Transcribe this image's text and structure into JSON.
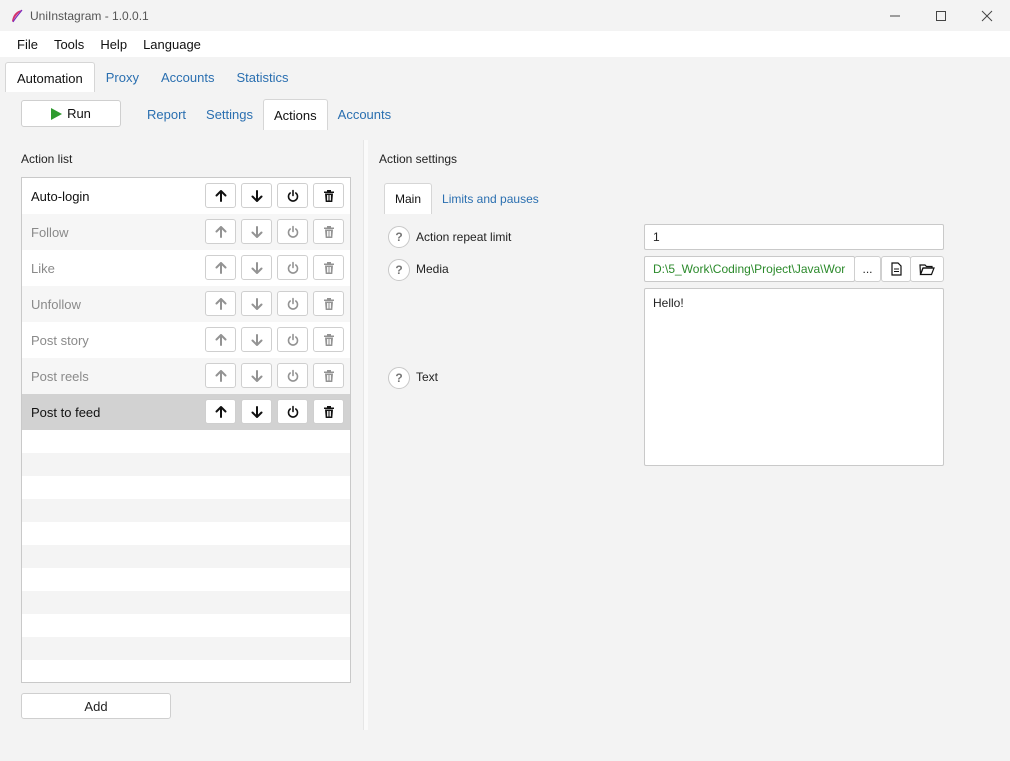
{
  "window": {
    "title": "UniInstagram - 1.0.0.1"
  },
  "menu": [
    "File",
    "Tools",
    "Help",
    "Language"
  ],
  "top_tabs": [
    {
      "label": "Automation",
      "active": true
    },
    {
      "label": "Proxy",
      "active": false
    },
    {
      "label": "Accounts",
      "active": false
    },
    {
      "label": "Statistics",
      "active": false
    }
  ],
  "toolbar": {
    "run_label": "Run"
  },
  "sub_tabs": [
    {
      "label": "Report",
      "active": false
    },
    {
      "label": "Settings",
      "active": false
    },
    {
      "label": "Actions",
      "active": true
    },
    {
      "label": "Accounts",
      "active": false
    }
  ],
  "action_list": {
    "title": "Action list",
    "items": [
      {
        "label": "Auto-login",
        "enabled": true,
        "selected": false
      },
      {
        "label": "Follow",
        "enabled": false,
        "selected": false
      },
      {
        "label": "Like",
        "enabled": false,
        "selected": false
      },
      {
        "label": "Unfollow",
        "enabled": false,
        "selected": false
      },
      {
        "label": "Post story",
        "enabled": false,
        "selected": false
      },
      {
        "label": "Post reels",
        "enabled": false,
        "selected": false
      },
      {
        "label": "Post to feed",
        "enabled": true,
        "selected": true
      }
    ],
    "add_label": "Add"
  },
  "action_settings": {
    "title": "Action settings",
    "tabs": [
      {
        "label": "Main",
        "active": true
      },
      {
        "label": "Limits and pauses",
        "active": false
      }
    ],
    "help_glyph": "?",
    "repeat_limit": {
      "label": "Action repeat limit",
      "value": "1"
    },
    "media": {
      "label": "Media",
      "value": "D:\\5_Work\\Coding\\Project\\Java\\Wor",
      "browse_label": "..."
    },
    "text": {
      "label": "Text",
      "value": "Hello!"
    }
  },
  "colors": {
    "accent_link": "#2a6fb0",
    "run_icon": "#2e9a2e",
    "media_path": "#2b8a2b",
    "selected_row": "#d2d2d2"
  },
  "icons": [
    "feather-logo-icon",
    "play-icon",
    "arrow-up-icon",
    "arrow-down-icon",
    "power-icon",
    "trash-icon",
    "file-icon",
    "folder-open-icon",
    "help-icon"
  ]
}
